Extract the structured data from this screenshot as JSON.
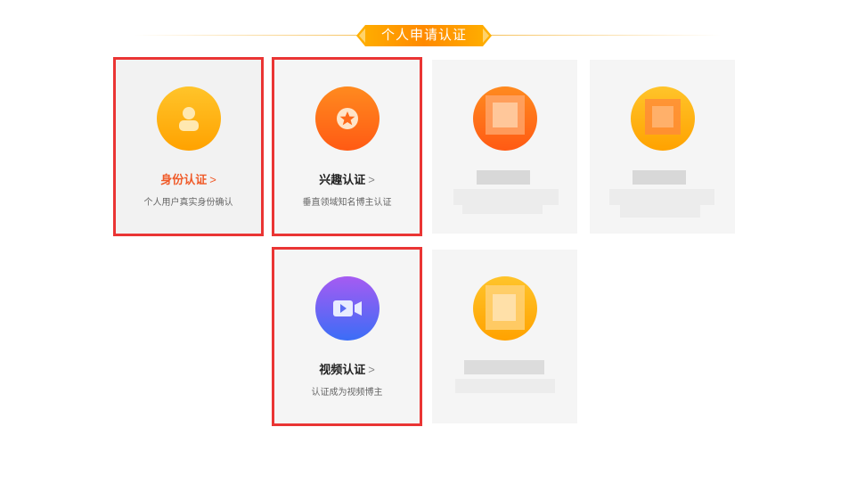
{
  "header": {
    "title": "个人申请认证"
  },
  "cards": [
    {
      "title": "身份认证",
      "chevron": ">",
      "desc": "个人用户真实身份确认"
    },
    {
      "title": "兴趣认证",
      "chevron": ">",
      "desc": "垂直领域知名博主认证"
    },
    {
      "title": "视频认证",
      "chevron": ">",
      "desc": "认证成为视频博主"
    }
  ],
  "colors": {
    "accent": "#f05a28",
    "highlight_border": "#ea3534",
    "badge": "#ff8a00",
    "orange_icon": "#ff6d1f",
    "yellow_icon": "#ffb300",
    "video_icon_top": "#a65bf2",
    "video_icon_bottom": "#3b6df6"
  }
}
